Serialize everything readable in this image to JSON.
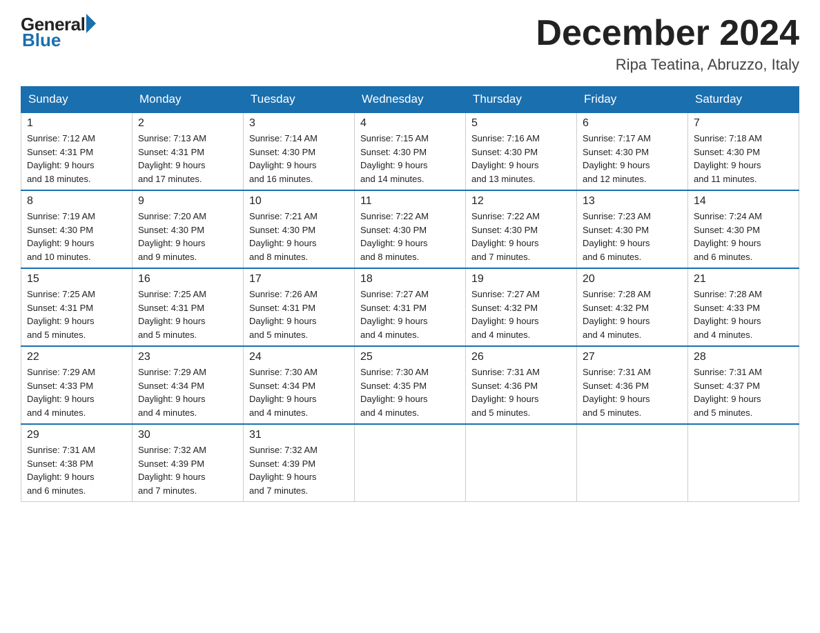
{
  "logo": {
    "general": "General",
    "blue": "Blue"
  },
  "title": "December 2024",
  "location": "Ripa Teatina, Abruzzo, Italy",
  "days_of_week": [
    "Sunday",
    "Monday",
    "Tuesday",
    "Wednesday",
    "Thursday",
    "Friday",
    "Saturday"
  ],
  "weeks": [
    [
      {
        "day": "1",
        "sunrise": "7:12 AM",
        "sunset": "4:31 PM",
        "daylight": "9 hours and 18 minutes."
      },
      {
        "day": "2",
        "sunrise": "7:13 AM",
        "sunset": "4:31 PM",
        "daylight": "9 hours and 17 minutes."
      },
      {
        "day": "3",
        "sunrise": "7:14 AM",
        "sunset": "4:30 PM",
        "daylight": "9 hours and 16 minutes."
      },
      {
        "day": "4",
        "sunrise": "7:15 AM",
        "sunset": "4:30 PM",
        "daylight": "9 hours and 14 minutes."
      },
      {
        "day": "5",
        "sunrise": "7:16 AM",
        "sunset": "4:30 PM",
        "daylight": "9 hours and 13 minutes."
      },
      {
        "day": "6",
        "sunrise": "7:17 AM",
        "sunset": "4:30 PM",
        "daylight": "9 hours and 12 minutes."
      },
      {
        "day": "7",
        "sunrise": "7:18 AM",
        "sunset": "4:30 PM",
        "daylight": "9 hours and 11 minutes."
      }
    ],
    [
      {
        "day": "8",
        "sunrise": "7:19 AM",
        "sunset": "4:30 PM",
        "daylight": "9 hours and 10 minutes."
      },
      {
        "day": "9",
        "sunrise": "7:20 AM",
        "sunset": "4:30 PM",
        "daylight": "9 hours and 9 minutes."
      },
      {
        "day": "10",
        "sunrise": "7:21 AM",
        "sunset": "4:30 PM",
        "daylight": "9 hours and 8 minutes."
      },
      {
        "day": "11",
        "sunrise": "7:22 AM",
        "sunset": "4:30 PM",
        "daylight": "9 hours and 8 minutes."
      },
      {
        "day": "12",
        "sunrise": "7:22 AM",
        "sunset": "4:30 PM",
        "daylight": "9 hours and 7 minutes."
      },
      {
        "day": "13",
        "sunrise": "7:23 AM",
        "sunset": "4:30 PM",
        "daylight": "9 hours and 6 minutes."
      },
      {
        "day": "14",
        "sunrise": "7:24 AM",
        "sunset": "4:30 PM",
        "daylight": "9 hours and 6 minutes."
      }
    ],
    [
      {
        "day": "15",
        "sunrise": "7:25 AM",
        "sunset": "4:31 PM",
        "daylight": "9 hours and 5 minutes."
      },
      {
        "day": "16",
        "sunrise": "7:25 AM",
        "sunset": "4:31 PM",
        "daylight": "9 hours and 5 minutes."
      },
      {
        "day": "17",
        "sunrise": "7:26 AM",
        "sunset": "4:31 PM",
        "daylight": "9 hours and 5 minutes."
      },
      {
        "day": "18",
        "sunrise": "7:27 AM",
        "sunset": "4:31 PM",
        "daylight": "9 hours and 4 minutes."
      },
      {
        "day": "19",
        "sunrise": "7:27 AM",
        "sunset": "4:32 PM",
        "daylight": "9 hours and 4 minutes."
      },
      {
        "day": "20",
        "sunrise": "7:28 AM",
        "sunset": "4:32 PM",
        "daylight": "9 hours and 4 minutes."
      },
      {
        "day": "21",
        "sunrise": "7:28 AM",
        "sunset": "4:33 PM",
        "daylight": "9 hours and 4 minutes."
      }
    ],
    [
      {
        "day": "22",
        "sunrise": "7:29 AM",
        "sunset": "4:33 PM",
        "daylight": "9 hours and 4 minutes."
      },
      {
        "day": "23",
        "sunrise": "7:29 AM",
        "sunset": "4:34 PM",
        "daylight": "9 hours and 4 minutes."
      },
      {
        "day": "24",
        "sunrise": "7:30 AM",
        "sunset": "4:34 PM",
        "daylight": "9 hours and 4 minutes."
      },
      {
        "day": "25",
        "sunrise": "7:30 AM",
        "sunset": "4:35 PM",
        "daylight": "9 hours and 4 minutes."
      },
      {
        "day": "26",
        "sunrise": "7:31 AM",
        "sunset": "4:36 PM",
        "daylight": "9 hours and 5 minutes."
      },
      {
        "day": "27",
        "sunrise": "7:31 AM",
        "sunset": "4:36 PM",
        "daylight": "9 hours and 5 minutes."
      },
      {
        "day": "28",
        "sunrise": "7:31 AM",
        "sunset": "4:37 PM",
        "daylight": "9 hours and 5 minutes."
      }
    ],
    [
      {
        "day": "29",
        "sunrise": "7:31 AM",
        "sunset": "4:38 PM",
        "daylight": "9 hours and 6 minutes."
      },
      {
        "day": "30",
        "sunrise": "7:32 AM",
        "sunset": "4:39 PM",
        "daylight": "9 hours and 7 minutes."
      },
      {
        "day": "31",
        "sunrise": "7:32 AM",
        "sunset": "4:39 PM",
        "daylight": "9 hours and 7 minutes."
      },
      null,
      null,
      null,
      null
    ]
  ],
  "labels": {
    "sunrise": "Sunrise:",
    "sunset": "Sunset:",
    "daylight": "Daylight:"
  }
}
